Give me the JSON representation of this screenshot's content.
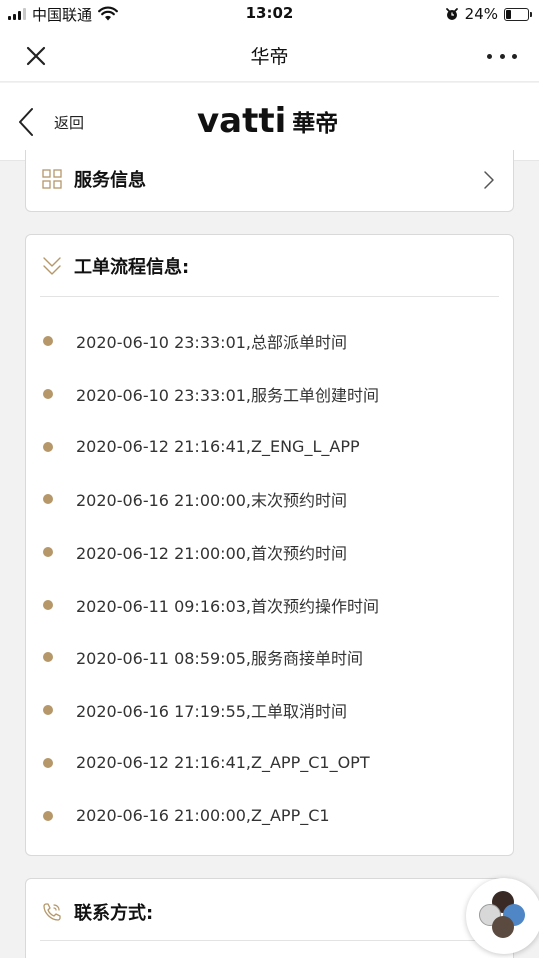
{
  "status_bar": {
    "carrier": "中国联通",
    "time": "13:02",
    "battery_percent": "24%",
    "battery_level": 0.24,
    "icons": [
      "signal-icon",
      "wifi-icon",
      "alarm-icon",
      "battery-icon"
    ]
  },
  "nav_bar": {
    "title": "华帝",
    "close_icon": "close-icon",
    "more_icon": "more-icon"
  },
  "brand_header": {
    "back_label": "返回",
    "logo_latin": "vatti",
    "logo_cjk": "華帝"
  },
  "service_info": {
    "heading": "服务信息",
    "icon": "grid-icon"
  },
  "work_order_flow": {
    "heading": "工单流程信息:",
    "icon": "double-chevron-down-icon",
    "dot_color": "#b5976a",
    "items": [
      {
        "text": "2020-06-10 23:33:01,总部派单时间"
      },
      {
        "text": "2020-06-10 23:33:01,服务工单创建时间"
      },
      {
        "text": "2020-06-12 21:16:41,Z_ENG_L_APP"
      },
      {
        "text": "2020-06-16 21:00:00,末次预约时间"
      },
      {
        "text": "2020-06-12 21:00:00,首次预约时间"
      },
      {
        "text": "2020-06-11 09:16:03,首次预约操作时间"
      },
      {
        "text": "2020-06-11 08:59:05,服务商接单时间"
      },
      {
        "text": "2020-06-16 17:19:55,工单取消时间"
      },
      {
        "text": "2020-06-12 21:16:41,Z_APP_C1_OPT"
      },
      {
        "text": "2020-06-16 21:00:00,Z_APP_C1"
      }
    ]
  },
  "contact": {
    "heading": "联系方式:",
    "icon": "phone-icon"
  },
  "floating_button": {
    "icon": "avatar-group-icon"
  }
}
